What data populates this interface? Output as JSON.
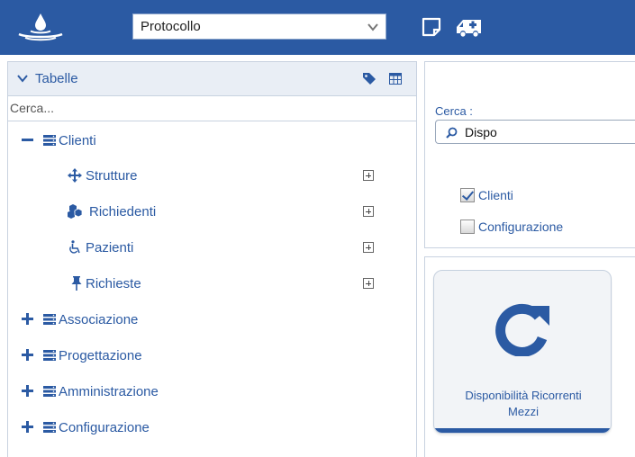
{
  "topbar": {
    "module_select": {
      "value": "Protocollo"
    },
    "icons": [
      "water-drop-logo-icon",
      "note-icon",
      "ambulance-icon"
    ]
  },
  "left_panel": {
    "title": "Tabelle",
    "search_placeholder": "Cerca...",
    "tree": [
      {
        "label": "Clienti",
        "expanded": true,
        "children": [
          {
            "label": "Strutture",
            "icon": "move-arrows-icon"
          },
          {
            "label": "Richiedenti",
            "icon": "cubes-icon"
          },
          {
            "label": "Pazienti",
            "icon": "wheelchair-icon"
          },
          {
            "label": "Richieste",
            "icon": "pushpin-icon"
          }
        ]
      },
      {
        "label": "Associazione",
        "expanded": false
      },
      {
        "label": "Progettazione",
        "expanded": false
      },
      {
        "label": "Amministrazione",
        "expanded": false
      },
      {
        "label": "Configurazione",
        "expanded": false
      }
    ]
  },
  "search_panel": {
    "label": "Cerca :",
    "value": "Dispo",
    "filters": [
      {
        "label": "Clienti",
        "checked": true
      },
      {
        "label": "Configurazione",
        "checked": false
      }
    ]
  },
  "result_tile": {
    "icon": "refresh-icon",
    "label_line1": "Disponibilità Ricorrenti",
    "label_line2": "Mezzi"
  },
  "colors": {
    "brand": "#2b5aa3",
    "panel_header": "#e9eef5"
  }
}
